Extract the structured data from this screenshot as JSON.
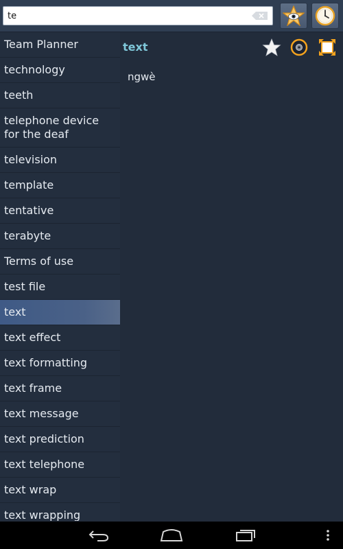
{
  "search": {
    "value": "te",
    "placeholder": ""
  },
  "toolbar": {
    "favorites_icon": "star-eye-icon",
    "history_icon": "clock-icon"
  },
  "wordlist": {
    "items": [
      {
        "label": "Team Planner"
      },
      {
        "label": "technology"
      },
      {
        "label": "teeth"
      },
      {
        "label": "telephone device for the deaf"
      },
      {
        "label": "television"
      },
      {
        "label": "template"
      },
      {
        "label": "tentative"
      },
      {
        "label": "terabyte"
      },
      {
        "label": "Terms of use"
      },
      {
        "label": "test file"
      },
      {
        "label": "text"
      },
      {
        "label": "text effect"
      },
      {
        "label": "text formatting"
      },
      {
        "label": "text frame"
      },
      {
        "label": "text message"
      },
      {
        "label": "text prediction"
      },
      {
        "label": "text telephone"
      },
      {
        "label": "text wrap"
      },
      {
        "label": "text wrapping"
      }
    ],
    "selected_index": 10
  },
  "detail": {
    "word": "text",
    "translation": "ngwè"
  },
  "colors": {
    "background": "#222c3b",
    "topbar": "#2f3e52",
    "accent_word": "#7fc7d9",
    "selected_row": "#4a6187",
    "icon_orange": "#f4a31e"
  }
}
